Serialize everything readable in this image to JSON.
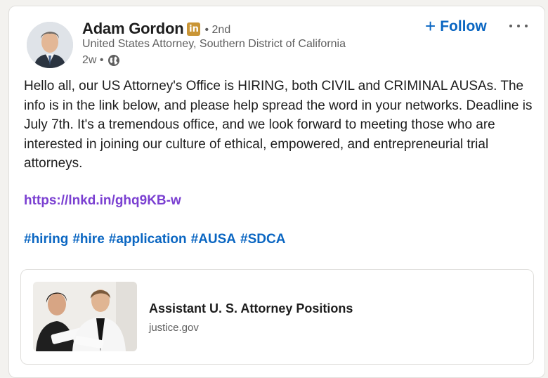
{
  "author": {
    "name": "Adam Gordon",
    "badge": "in",
    "degree": "• 2nd",
    "headline": "United States Attorney, Southern District of California",
    "time": "2w •"
  },
  "actions": {
    "follow_icon": "+",
    "follow_label": "Follow",
    "more_icon": "ellipsis-icon"
  },
  "post": {
    "text": "Hello all, our US Attorney's Office is HIRING, both CIVIL and CRIMINAL AUSAs. The info is in the link below, and please help spread the word in your networks. Deadline is July 7th. It's a tremendous office, and we look forward to meeting those who are interested in joining our culture of ethical, empowered, and entrepreneurial trial attorneys.",
    "link": "https://lnkd.in/ghq9KB-w",
    "hashtags": [
      "#hiring",
      "#hire",
      "#application",
      "#AUSA",
      "#SDCA"
    ]
  },
  "preview": {
    "title": "Assistant U. S. Attorney Positions",
    "domain": "justice.gov"
  },
  "colors": {
    "accent": "#0a66c2",
    "link": "#7a3fd1",
    "premium_badge": "#c99536",
    "muted_text": "#5f5f5f"
  }
}
